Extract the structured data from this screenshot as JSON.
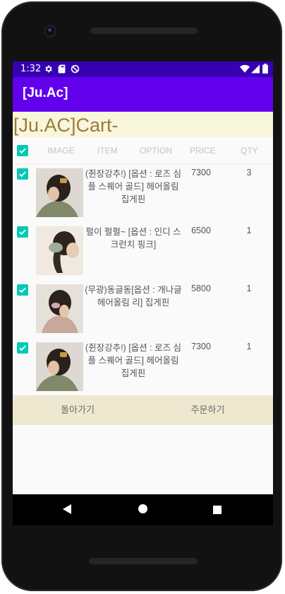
{
  "status_bar": {
    "time": "1:32",
    "icons": [
      "settings-gear-icon",
      "sd-card-icon",
      "do-not-disturb-icon",
      "wifi-icon",
      "signal-icon",
      "battery-icon"
    ]
  },
  "app_bar": {
    "title": "[Ju.Ac]"
  },
  "page": {
    "title": "[Ju.AC]Cart-"
  },
  "table": {
    "headers": [
      "IMAGE",
      "ITEM",
      "OPTION",
      "PRICE",
      "QTY"
    ],
    "select_all_checked": true,
    "rows": [
      {
        "name": "(쥔장강추!) [옵션 : 로즈 심플 스퀘어 골드] 헤어올림 집게핀",
        "price": "7300",
        "qty": "3",
        "checked": true
      },
      {
        "name": "펄이 펄펄~ [옵션 : 인디 스크런치 핑크]",
        "price": "6500",
        "qty": "1",
        "checked": true
      },
      {
        "name": "(무광)동글동[옵션 : 개나글 헤어올림 리] 집게핀",
        "price": "5800",
        "qty": "1",
        "checked": true
      },
      {
        "name": "(쥔장강추!) [옵션 : 로즈 심플 스퀘어 골드] 헤어올림 집게핀",
        "price": "7300",
        "qty": "1",
        "checked": true
      }
    ]
  },
  "footer": {
    "back_label": "돌아가기",
    "order_label": "주문하기"
  },
  "colors": {
    "app_bar": "#6200ee",
    "status_bar": "#3700b3",
    "checkbox": "#03c9b4",
    "title_text": "#9a7c3a",
    "heading_bg": "#f8f6dc",
    "footer_bg": "#eee8d0"
  }
}
